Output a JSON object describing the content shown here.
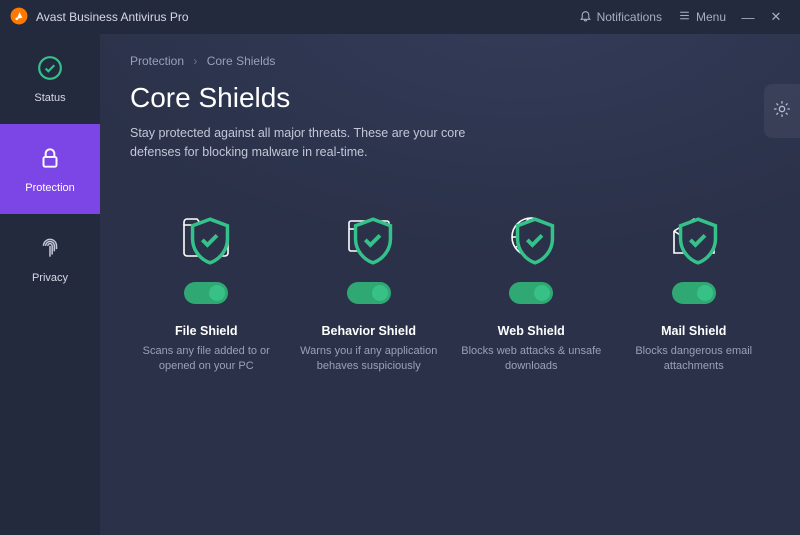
{
  "titlebar": {
    "app_name": "Avast Business Antivirus Pro",
    "notifications": "Notifications",
    "menu": "Menu"
  },
  "sidebar": {
    "status": "Status",
    "protection": "Protection",
    "privacy": "Privacy"
  },
  "breadcrumb": {
    "root": "Protection",
    "current": "Core Shields"
  },
  "page": {
    "title": "Core Shields",
    "subtitle": "Stay protected against all major threats. These are your core defenses for blocking malware in real-time."
  },
  "shields": [
    {
      "name": "File Shield",
      "desc": "Scans any file added to or opened on your PC",
      "enabled": true
    },
    {
      "name": "Behavior Shield",
      "desc": "Warns you if any application behaves suspiciously",
      "enabled": true
    },
    {
      "name": "Web Shield",
      "desc": "Blocks web attacks & unsafe downloads",
      "enabled": true
    },
    {
      "name": "Mail Shield",
      "desc": "Blocks dangerous email attachments",
      "enabled": true
    }
  ],
  "colors": {
    "accent": "#7c45e6",
    "toggle_on": "#2fa874",
    "bg": "#2a3148"
  }
}
